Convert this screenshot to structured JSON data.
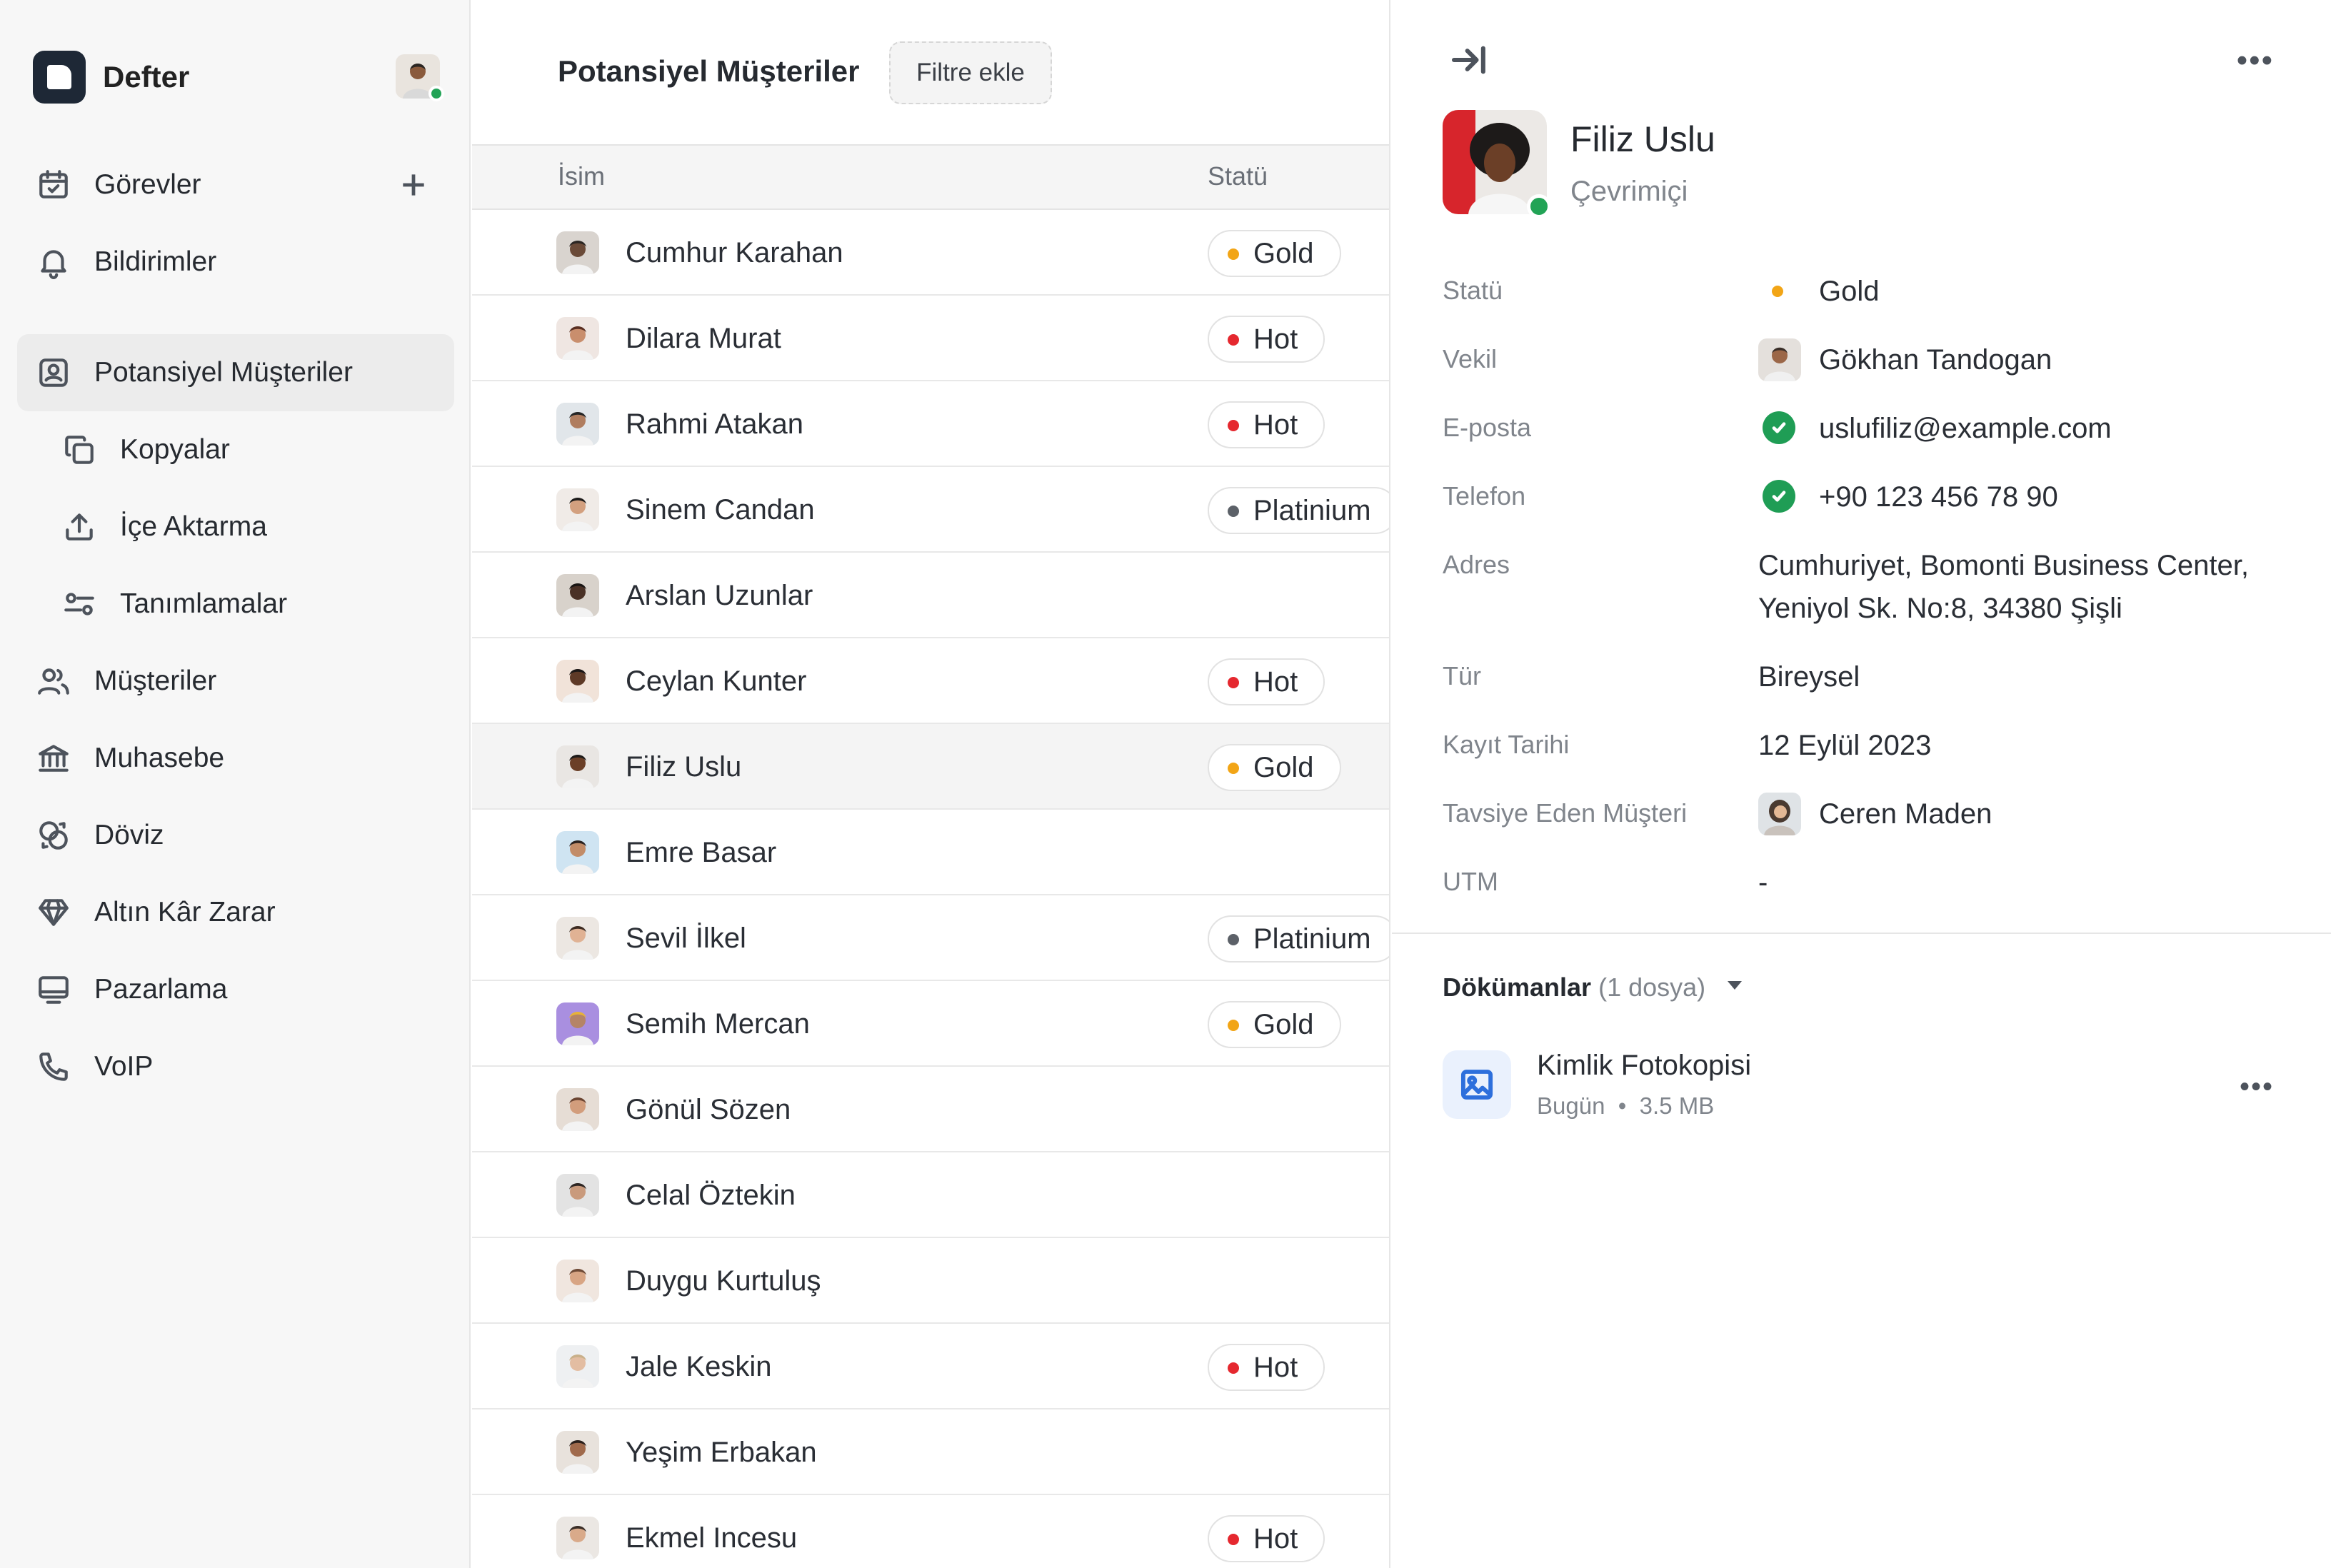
{
  "app": {
    "name": "Defter"
  },
  "sidebar": {
    "items": [
      {
        "label": "Görevler",
        "icon": "calendar-icon"
      },
      {
        "label": "Bildirimler",
        "icon": "bell-icon"
      },
      {
        "label": "Potansiyel Müşteriler",
        "icon": "contact-card-icon",
        "active": true
      },
      {
        "label": "Kopyalar",
        "icon": "copy-icon"
      },
      {
        "label": "İçe Aktarma",
        "icon": "upload-icon"
      },
      {
        "label": "Tanımlamalar",
        "icon": "sliders-icon"
      },
      {
        "label": "Müşteriler",
        "icon": "users-icon"
      },
      {
        "label": "Muhasebe",
        "icon": "bank-icon"
      },
      {
        "label": "Döviz",
        "icon": "coins-icon"
      },
      {
        "label": "Altın Kâr Zarar",
        "icon": "diamond-icon"
      },
      {
        "label": "Pazarlama",
        "icon": "monitor-icon"
      },
      {
        "label": "VoIP",
        "icon": "phone-icon"
      }
    ]
  },
  "main": {
    "title": "Potansiyel Müşteriler",
    "filter_label": "Filtre ekle",
    "columns": {
      "name": "İsim",
      "status": "Statü"
    },
    "rows": [
      {
        "name": "Cumhur Karahan",
        "status": "Gold"
      },
      {
        "name": "Dilara Murat",
        "status": "Hot"
      },
      {
        "name": "Rahmi Atakan",
        "status": "Hot"
      },
      {
        "name": "Sinem Candan",
        "status": "Platinium"
      },
      {
        "name": "Arslan Uzunlar",
        "status": ""
      },
      {
        "name": "Ceylan Kunter",
        "status": "Hot"
      },
      {
        "name": "Filiz Uslu",
        "status": "Gold",
        "selected": true
      },
      {
        "name": "Emre Basar",
        "status": ""
      },
      {
        "name": "Sevil İlkel",
        "status": "Platinium"
      },
      {
        "name": "Semih Mercan",
        "status": "Gold"
      },
      {
        "name": "Gönül Sözen",
        "status": ""
      },
      {
        "name": "Celal Öztekin",
        "status": ""
      },
      {
        "name": "Duygu Kurtuluş",
        "status": ""
      },
      {
        "name": "Jale Keskin",
        "status": "Hot"
      },
      {
        "name": "Yeşim Erbakan",
        "status": ""
      },
      {
        "name": "Ekmel Incesu",
        "status": "Hot"
      }
    ]
  },
  "status_colors": {
    "Gold": "#f2a516",
    "Hot": "#e5282f",
    "Platinium": "#5c6168"
  },
  "detail": {
    "name": "Filiz Uslu",
    "presence": "Çevrimiçi",
    "fields": {
      "status": {
        "label": "Statü",
        "value": "Gold"
      },
      "agent": {
        "label": "Vekil",
        "value": "Gökhan Tandogan"
      },
      "email": {
        "label": "E-posta",
        "value": "uslufiliz@example.com"
      },
      "phone": {
        "label": "Telefon",
        "value": "+90 123 456 78 90"
      },
      "address": {
        "label": "Adres",
        "line1": "Cumhuriyet, Bomonti Business Center,",
        "line2": "Yeniyol Sk. No:8, 34380 Şişli"
      },
      "type": {
        "label": "Tür",
        "value": "Bireysel"
      },
      "registered": {
        "label": "Kayıt Tarihi",
        "value": "12 Eylül 2023"
      },
      "referrer": {
        "label": "Tavsiye Eden Müşteri",
        "value": "Ceren Maden"
      },
      "utm": {
        "label": "UTM",
        "value": "-"
      }
    },
    "documents": {
      "title": "Dökümanlar",
      "count": "(1 dosya)",
      "items": [
        {
          "name": "Kimlik Fotokopisi",
          "date": "Bugün",
          "size": "3.5 MB"
        }
      ]
    }
  }
}
